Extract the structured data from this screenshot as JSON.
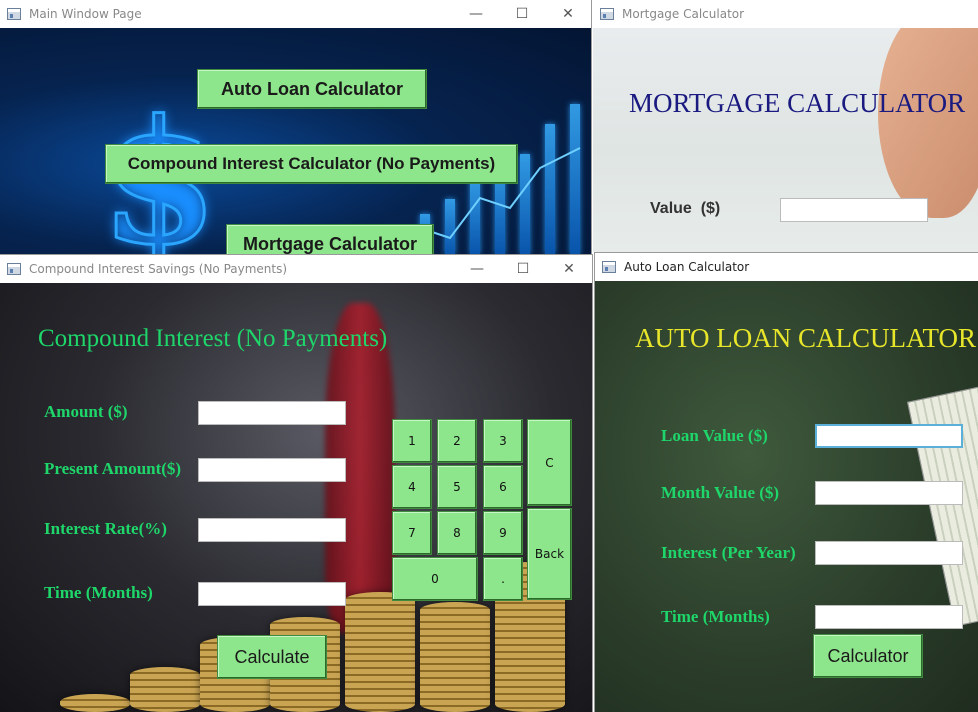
{
  "windows": {
    "main": {
      "title": "Main Window Page",
      "buttons": {
        "auto_loan": "Auto Loan Calculator",
        "compound": "Compound Interest Calculator (No Payments)",
        "mortgage": "Mortgage Calculator"
      }
    },
    "mortgage": {
      "title": "Mortgage Calculator",
      "heading": "MORTGAGE CALCULATOR",
      "value_label": "Value  ($)",
      "value_field": ""
    },
    "compound": {
      "title": "Compound Interest Savings (No Payments)",
      "heading": "Compound Interest (No Payments)",
      "labels": {
        "amount": "Amount ($)",
        "present": "Present Amount($)",
        "rate": "Interest Rate(%)",
        "time": "Time (Months)"
      },
      "fields": {
        "amount": "",
        "present": "",
        "rate": "",
        "time": ""
      },
      "keypad": {
        "k1": "1",
        "k2": "2",
        "k3": "3",
        "clear": "C",
        "k4": "4",
        "k5": "5",
        "k6": "6",
        "k7": "7",
        "k8": "8",
        "k9": "9",
        "back": "Back",
        "k0": "0",
        "dot": "."
      },
      "calculate": "Calculate"
    },
    "auto": {
      "title": "Auto Loan Calculator",
      "heading": "AUTO LOAN CALCULATOR",
      "labels": {
        "loan": "Loan Value ($)",
        "month": "Month Value ($)",
        "interest": "Interest (Per Year)",
        "time": "Time (Months)"
      },
      "fields": {
        "loan": "",
        "month": "",
        "interest": "",
        "time": ""
      },
      "calculate": "Calculator"
    }
  },
  "controls": {
    "minimize": "—",
    "maximize": "☐",
    "close": "✕"
  }
}
